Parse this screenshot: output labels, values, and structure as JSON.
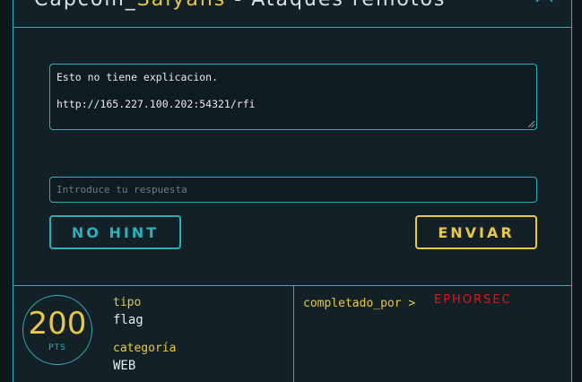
{
  "modal": {
    "title_prefix": "Capcom_",
    "title_highlight": "Saiyans",
    "title_suffix": " - Ataques remotos"
  },
  "challenge": {
    "description_line1": "Esto no tiene explicacion.",
    "description_line2": "http://165.227.100.202:54321/rfi"
  },
  "answer": {
    "placeholder": "Introduce tu respuesta",
    "value": ""
  },
  "buttons": {
    "hint_label": "NO HINT",
    "send_label": "ENVIAR"
  },
  "info": {
    "points_value": "200",
    "points_unit": "PTS",
    "type_label": "tipo",
    "type_value": "flag",
    "category_label": "categoría",
    "category_value": "WEB",
    "completed_label": "completado_por >",
    "completed_user": "EPHORSEC"
  },
  "colors": {
    "accent": "#2ab0bd",
    "highlight": "#e7c84a",
    "alert": "#e0141a",
    "background": "#132127"
  },
  "icons": {
    "close": "close-icon"
  }
}
